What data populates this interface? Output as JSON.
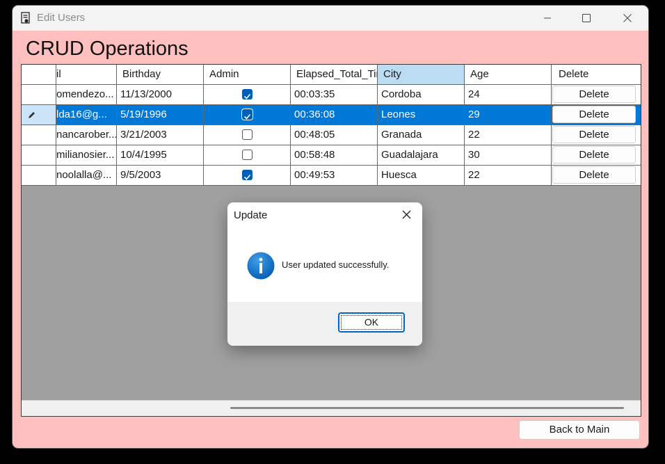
{
  "window": {
    "title": "Edit Users"
  },
  "page": {
    "heading": "CRUD Operations",
    "back_button": "Back to Main"
  },
  "grid": {
    "columns": [
      "il",
      "Birthday",
      "Admin",
      "Elapsed_Total_Tir",
      "City",
      "Age",
      "Delete"
    ],
    "rows": [
      {
        "email": "omendezo...",
        "birthday": "11/13/2000",
        "admin": true,
        "elapsed": "00:03:35",
        "city": "Cordoba",
        "age": "24",
        "delete": "Delete"
      },
      {
        "email": "lda16@g...",
        "birthday": "5/19/1996",
        "admin": true,
        "elapsed": "00:36:08",
        "city": "Leones",
        "age": "29",
        "delete": "Delete"
      },
      {
        "email": "nancarober...",
        "birthday": "3/21/2003",
        "admin": false,
        "elapsed": "00:48:05",
        "city": "Granada",
        "age": "22",
        "delete": "Delete"
      },
      {
        "email": "milianosier...",
        "birthday": "10/4/1995",
        "admin": false,
        "elapsed": "00:58:48",
        "city": "Guadalajara",
        "age": "30",
        "delete": "Delete"
      },
      {
        "email": "noolalla@...",
        "birthday": "9/5/2003",
        "admin": true,
        "elapsed": "00:49:53",
        "city": "Huesca",
        "age": "22",
        "delete": "Delete"
      }
    ],
    "selected_row": 1,
    "highlighted_column": "City"
  },
  "dialog": {
    "title": "Update",
    "message": "User updated successfully.",
    "ok_label": "OK",
    "icon": "info-icon"
  },
  "colors": {
    "window_bg": "#ffbfbf",
    "selection": "#0078d7",
    "header_highlight": "#bcdcf4",
    "checkbox_checked": "#005fb8",
    "grid_empty": "#a0a0a0"
  }
}
